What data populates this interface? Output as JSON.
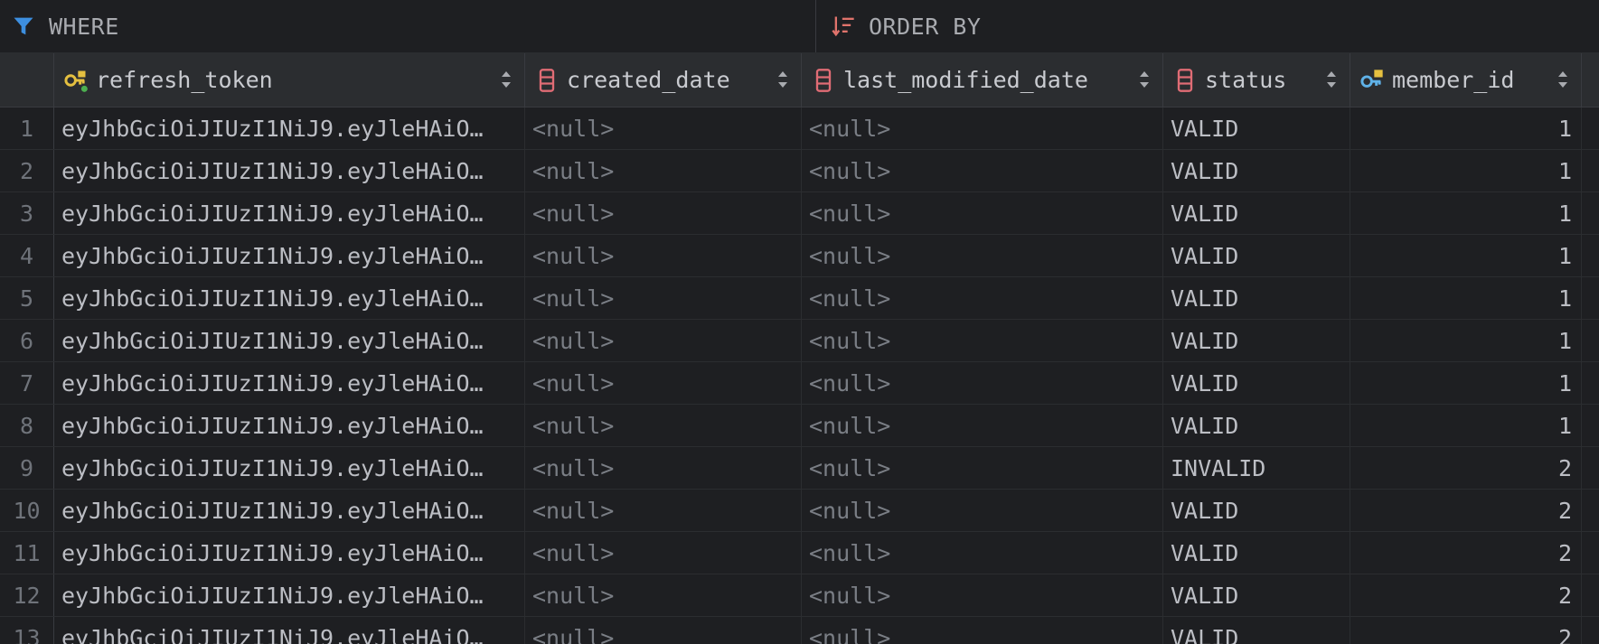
{
  "filter_bar": {
    "where_label": "WHERE",
    "order_by_label": "ORDER BY"
  },
  "columns": [
    {
      "name": "refresh_token",
      "icon": "primary-key-icon"
    },
    {
      "name": "created_date",
      "icon": "column-icon"
    },
    {
      "name": "last_modified_date",
      "icon": "column-icon"
    },
    {
      "name": "status",
      "icon": "column-icon"
    },
    {
      "name": "member_id",
      "icon": "foreign-key-icon"
    }
  ],
  "rows": [
    {
      "num": "1",
      "refresh_token": "eyJhbGciOiJIUzI1NiJ9.eyJleHAiO…",
      "created_date": "<null>",
      "last_modified_date": "<null>",
      "status": "VALID",
      "member_id": "1"
    },
    {
      "num": "2",
      "refresh_token": "eyJhbGciOiJIUzI1NiJ9.eyJleHAiO…",
      "created_date": "<null>",
      "last_modified_date": "<null>",
      "status": "VALID",
      "member_id": "1"
    },
    {
      "num": "3",
      "refresh_token": "eyJhbGciOiJIUzI1NiJ9.eyJleHAiO…",
      "created_date": "<null>",
      "last_modified_date": "<null>",
      "status": "VALID",
      "member_id": "1"
    },
    {
      "num": "4",
      "refresh_token": "eyJhbGciOiJIUzI1NiJ9.eyJleHAiO…",
      "created_date": "<null>",
      "last_modified_date": "<null>",
      "status": "VALID",
      "member_id": "1"
    },
    {
      "num": "5",
      "refresh_token": "eyJhbGciOiJIUzI1NiJ9.eyJleHAiO…",
      "created_date": "<null>",
      "last_modified_date": "<null>",
      "status": "VALID",
      "member_id": "1"
    },
    {
      "num": "6",
      "refresh_token": "eyJhbGciOiJIUzI1NiJ9.eyJleHAiO…",
      "created_date": "<null>",
      "last_modified_date": "<null>",
      "status": "VALID",
      "member_id": "1"
    },
    {
      "num": "7",
      "refresh_token": "eyJhbGciOiJIUzI1NiJ9.eyJleHAiO…",
      "created_date": "<null>",
      "last_modified_date": "<null>",
      "status": "VALID",
      "member_id": "1"
    },
    {
      "num": "8",
      "refresh_token": "eyJhbGciOiJIUzI1NiJ9.eyJleHAiO…",
      "created_date": "<null>",
      "last_modified_date": "<null>",
      "status": "VALID",
      "member_id": "1"
    },
    {
      "num": "9",
      "refresh_token": "eyJhbGciOiJIUzI1NiJ9.eyJleHAiO…",
      "created_date": "<null>",
      "last_modified_date": "<null>",
      "status": "INVALID",
      "member_id": "2"
    },
    {
      "num": "10",
      "refresh_token": "eyJhbGciOiJIUzI1NiJ9.eyJleHAiO…",
      "created_date": "<null>",
      "last_modified_date": "<null>",
      "status": "VALID",
      "member_id": "2"
    },
    {
      "num": "11",
      "refresh_token": "eyJhbGciOiJIUzI1NiJ9.eyJleHAiO…",
      "created_date": "<null>",
      "last_modified_date": "<null>",
      "status": "VALID",
      "member_id": "2"
    },
    {
      "num": "12",
      "refresh_token": "eyJhbGciOiJIUzI1NiJ9.eyJleHAiO…",
      "created_date": "<null>",
      "last_modified_date": "<null>",
      "status": "VALID",
      "member_id": "2"
    },
    {
      "num": "13",
      "refresh_token": "eyJhbGciOiJIUzI1NiJ9.eyJleHAiO…",
      "created_date": "<null>",
      "last_modified_date": "<null>",
      "status": "VALID",
      "member_id": "2"
    }
  ],
  "colors": {
    "background": "#1e1f22",
    "header_background": "#2b2d30",
    "filter_icon": "#3d8fe0",
    "order_icon": "#e0736c",
    "primary_key_icon": "#e5c040",
    "foreign_key_icon": "#5fb2e8",
    "column_icon": "#e06c75"
  }
}
